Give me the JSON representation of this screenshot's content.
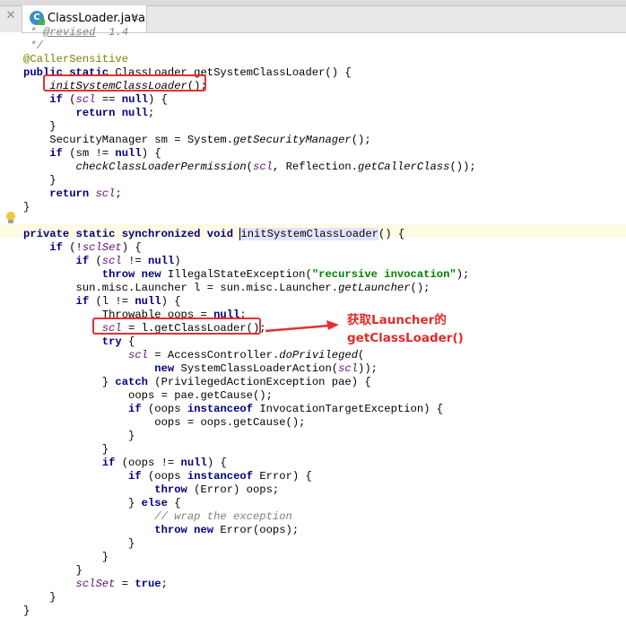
{
  "tab": {
    "close_left": "✕",
    "file_icon_letter": "C",
    "file_name": "ClassLoader.java",
    "close": "×"
  },
  "annotation": {
    "line1": "获取Launcher的",
    "line2": "getClassLoader()"
  },
  "colors": {
    "accent_red": "#e53030",
    "keyword": "#000080",
    "field": "#660e7a",
    "string": "#008000",
    "comment": "#808080"
  },
  "code": {
    "l0_at": "@revised",
    "l0_ver": "1.4",
    "l1": " */",
    "l2": "@CallerSensitive",
    "l3_kw": "public static",
    "l3_rest": " ClassLoader getSystemClassLoader() {",
    "l4_call": "initSystemClassLoader",
    "l4_end": "();",
    "l5_kw": "if",
    "l5_a": " (",
    "l5_fld": "scl",
    "l5_b": " == ",
    "l5_null": "null",
    "l5_c": ") {",
    "l6_kw": "return null",
    "l6_end": ";",
    "l7": "    }",
    "l8_a": "    SecurityManager sm = System.",
    "l8_it": "getSecurityManager",
    "l8_b": "();",
    "l9_kw": "if",
    "l9_a": " (sm != ",
    "l9_null": "null",
    "l9_b": ") {",
    "l10_it": "checkClassLoaderPermission",
    "l10_a": "(",
    "l10_fld": "scl",
    "l10_b": ", Reflection.",
    "l10_it2": "getCallerClass",
    "l10_c": "());",
    "l11": "    }",
    "l12_kw": "return",
    "l12_fld": "scl",
    "l12_end": ";",
    "l13": "}",
    "l15_kw": "private static synchronized void",
    "l15_name": "initSystemClassLoader",
    "l15_end": "() {",
    "l16_kw": "if",
    "l16_a": " (!",
    "l16_fld": "sclSet",
    "l16_b": ") {",
    "l17_kw": "if",
    "l17_a": " (",
    "l17_fld": "scl",
    "l17_b": " != ",
    "l17_null": "null",
    "l17_c": ")",
    "l18_kw": "throw new",
    "l18_a": " IllegalStateException(",
    "l18_str": "\"recursive invocation\"",
    "l18_b": ");",
    "l19_a": "        sun.misc.Launcher l = sun.misc.Launcher.",
    "l19_it": "getLauncher",
    "l19_b": "();",
    "l20_kw": "if",
    "l20_a": " (l != ",
    "l20_null": "null",
    "l20_b": ") {",
    "l21_a": "            Throwable oops = ",
    "l21_null": "null",
    "l21_b": ";",
    "l22_fld": "scl",
    "l22_a": " = l.getClassLoader();",
    "l23_kw": "try",
    "l23_a": " {",
    "l24_fld": "scl",
    "l24_a": " = AccessController.",
    "l24_it": "doPrivileged",
    "l24_b": "(",
    "l25_kw": "new",
    "l25_a": " SystemClassLoaderAction(",
    "l25_fld": "scl",
    "l25_b": "));",
    "l26_a": "} ",
    "l26_kw": "catch",
    "l26_b": " (PrivilegedActionException pae) {",
    "l27": "                oops = pae.getCause();",
    "l28_kw": "if",
    "l28_a": " (oops ",
    "l28_kw2": "instanceof",
    "l28_b": " InvocationTargetException) {",
    "l29": "                    oops = oops.getCause();",
    "l30": "                }",
    "l31": "            }",
    "l32_kw": "if",
    "l32_a": " (oops != ",
    "l32_null": "null",
    "l32_b": ") {",
    "l33_kw": "if",
    "l33_a": " (oops ",
    "l33_kw2": "instanceof",
    "l33_b": " Error) {",
    "l34_kw": "throw",
    "l34_a": " (Error) oops;",
    "l35_a": "} ",
    "l35_kw": "else",
    "l35_b": " {",
    "l36": "// wrap the exception",
    "l37_kw": "throw new",
    "l37_a": " Error(oops);",
    "l38": "                }",
    "l39": "            }",
    "l40": "        }",
    "l41_fld": "sclSet",
    "l41_a": " = ",
    "l41_kw": "true",
    "l41_b": ";",
    "l42": "    }",
    "l43": "}"
  }
}
